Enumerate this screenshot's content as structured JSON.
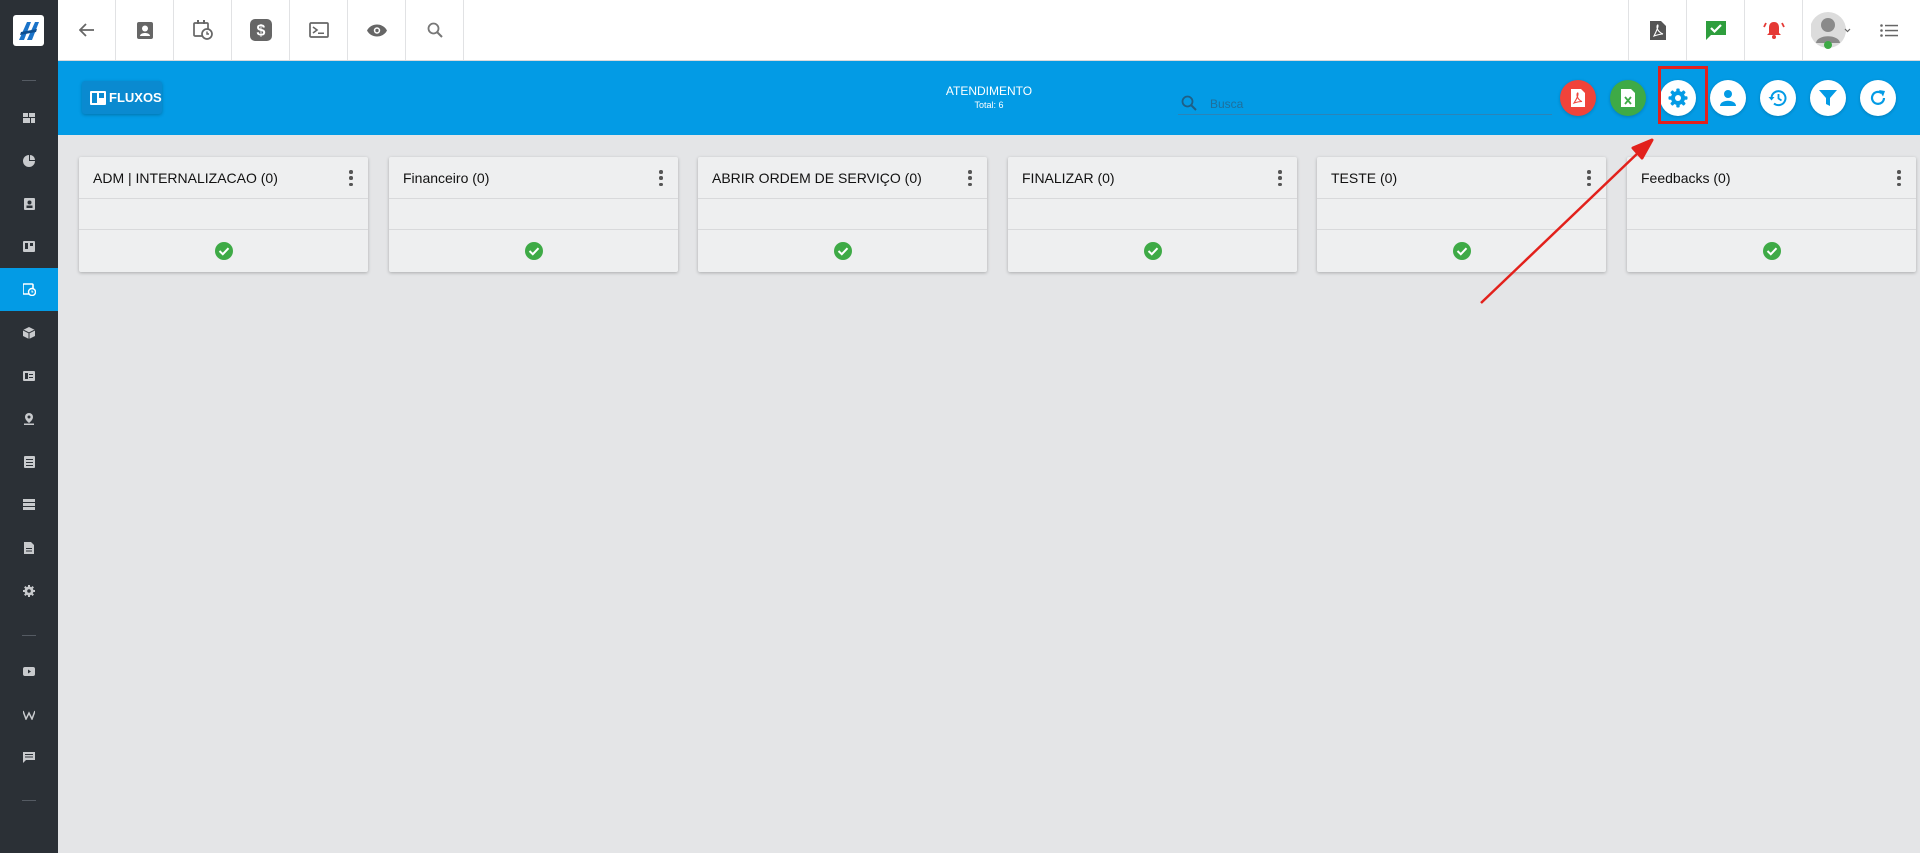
{
  "header": {
    "title": "ATENDIMENTO",
    "total": "Total: 6",
    "badge": "FLUXOS",
    "search_placeholder": "Busca"
  },
  "sidebar": {
    "items": [
      {
        "icon": "dashboard-icon"
      },
      {
        "icon": "pie-chart-icon"
      },
      {
        "icon": "contact-card-icon"
      },
      {
        "icon": "kanban-icon"
      },
      {
        "icon": "calendar-clock-icon",
        "active": true
      },
      {
        "icon": "box-icon"
      },
      {
        "icon": "ticket-icon"
      },
      {
        "icon": "map-pin-icon"
      },
      {
        "icon": "list-icon"
      },
      {
        "icon": "server-icon"
      },
      {
        "icon": "document-icon"
      },
      {
        "icon": "gear-icon"
      },
      {
        "icon": "youtube-icon"
      },
      {
        "icon": "wikipedia-icon"
      },
      {
        "icon": "chat-icon"
      }
    ]
  },
  "toolbar": {
    "left_icons": [
      "back-arrow-icon",
      "contact-icon",
      "calendar-clock-icon",
      "dollar-icon",
      "terminal-icon",
      "eye-icon",
      "search-icon"
    ],
    "right_icons": [
      "pdf-icon",
      "chat-check-icon",
      "alarm-bell-icon",
      "avatar",
      "menu-list-icon"
    ]
  },
  "header_actions": [
    "export-pdf-icon",
    "export-excel-icon",
    "settings-icon",
    "user-icon",
    "history-icon",
    "filter-icon",
    "refresh-icon"
  ],
  "columns": [
    {
      "title": "ADM | INTERNALIZACAO (0)"
    },
    {
      "title": "Financeiro (0)"
    },
    {
      "title": "ABRIR ORDEM DE SERVIÇO (0)"
    },
    {
      "title": "FINALIZAR (0)"
    },
    {
      "title": "TESTE (0)"
    },
    {
      "title": "Feedbacks (0)"
    }
  ],
  "colors": {
    "sidebar": "#2b3036",
    "accent": "#039be5",
    "danger": "#f0433a",
    "success": "#3eaa46",
    "annotation": "#e2211c"
  }
}
